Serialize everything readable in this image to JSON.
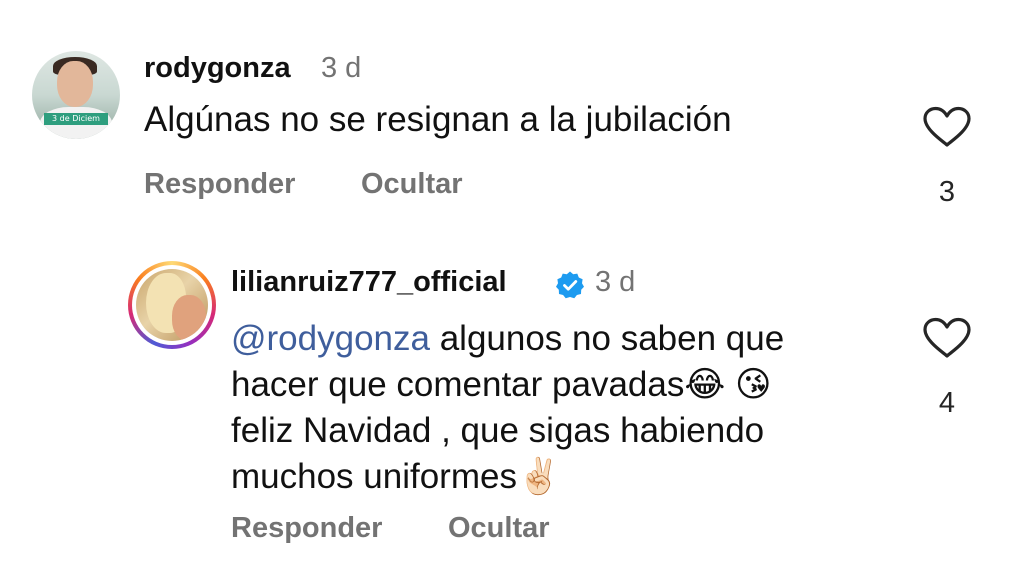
{
  "comments": [
    {
      "username": "rodygonza",
      "time": "3 d",
      "avatar_banner_text": "3 de Diciem",
      "text": "Algúnas no se resignan a la jubilación",
      "reply_label": "Responder",
      "hide_label": "Ocultar",
      "like_count": "3",
      "like_icon": "heart-outline-icon",
      "verified": false
    },
    {
      "username": "lilianruiz777_official",
      "time": "3 d",
      "verified": true,
      "verified_icon": "verified-badge-icon",
      "mention": "@rodygonza",
      "text_line1": " algunos no saben que",
      "text_line2": "hacer que comentar pavadas",
      "emoji1": "😂",
      "emoji2": "😘",
      "text_line3": "feliz Navidad , que sigas habiendo",
      "text_line4": "muchos uniformes",
      "emoji3": "✌🏻",
      "reply_label": "Responder",
      "hide_label": "Ocultar",
      "like_count": "4",
      "like_icon": "heart-outline-icon"
    }
  ],
  "colors": {
    "text_primary": "#111111",
    "text_secondary": "#737373",
    "mention": "#3f5e9c",
    "verified_blue": "#1d9bf0",
    "story_ring": [
      "#feda75",
      "#fa7e1e",
      "#d62976",
      "#962fbf",
      "#4f5bd5"
    ]
  }
}
